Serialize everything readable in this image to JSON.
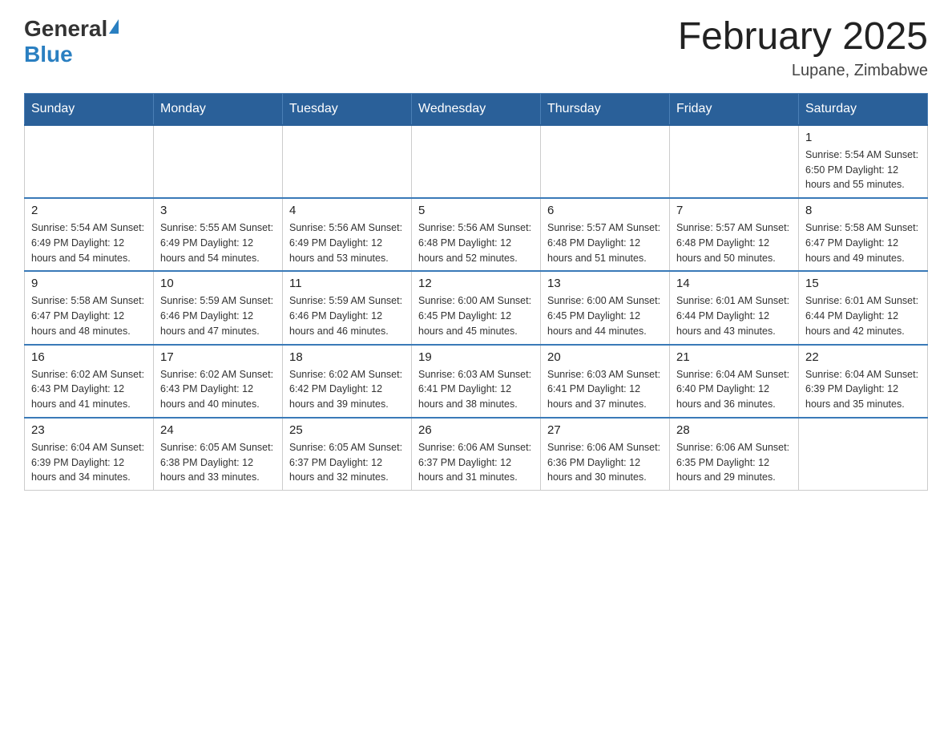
{
  "header": {
    "logo_general": "General",
    "logo_blue": "Blue",
    "month_title": "February 2025",
    "location": "Lupane, Zimbabwe"
  },
  "days_of_week": [
    "Sunday",
    "Monday",
    "Tuesday",
    "Wednesday",
    "Thursday",
    "Friday",
    "Saturday"
  ],
  "weeks": [
    {
      "days": [
        {
          "date": "",
          "info": ""
        },
        {
          "date": "",
          "info": ""
        },
        {
          "date": "",
          "info": ""
        },
        {
          "date": "",
          "info": ""
        },
        {
          "date": "",
          "info": ""
        },
        {
          "date": "",
          "info": ""
        },
        {
          "date": "1",
          "info": "Sunrise: 5:54 AM\nSunset: 6:50 PM\nDaylight: 12 hours\nand 55 minutes."
        }
      ]
    },
    {
      "days": [
        {
          "date": "2",
          "info": "Sunrise: 5:54 AM\nSunset: 6:49 PM\nDaylight: 12 hours\nand 54 minutes."
        },
        {
          "date": "3",
          "info": "Sunrise: 5:55 AM\nSunset: 6:49 PM\nDaylight: 12 hours\nand 54 minutes."
        },
        {
          "date": "4",
          "info": "Sunrise: 5:56 AM\nSunset: 6:49 PM\nDaylight: 12 hours\nand 53 minutes."
        },
        {
          "date": "5",
          "info": "Sunrise: 5:56 AM\nSunset: 6:48 PM\nDaylight: 12 hours\nand 52 minutes."
        },
        {
          "date": "6",
          "info": "Sunrise: 5:57 AM\nSunset: 6:48 PM\nDaylight: 12 hours\nand 51 minutes."
        },
        {
          "date": "7",
          "info": "Sunrise: 5:57 AM\nSunset: 6:48 PM\nDaylight: 12 hours\nand 50 minutes."
        },
        {
          "date": "8",
          "info": "Sunrise: 5:58 AM\nSunset: 6:47 PM\nDaylight: 12 hours\nand 49 minutes."
        }
      ]
    },
    {
      "days": [
        {
          "date": "9",
          "info": "Sunrise: 5:58 AM\nSunset: 6:47 PM\nDaylight: 12 hours\nand 48 minutes."
        },
        {
          "date": "10",
          "info": "Sunrise: 5:59 AM\nSunset: 6:46 PM\nDaylight: 12 hours\nand 47 minutes."
        },
        {
          "date": "11",
          "info": "Sunrise: 5:59 AM\nSunset: 6:46 PM\nDaylight: 12 hours\nand 46 minutes."
        },
        {
          "date": "12",
          "info": "Sunrise: 6:00 AM\nSunset: 6:45 PM\nDaylight: 12 hours\nand 45 minutes."
        },
        {
          "date": "13",
          "info": "Sunrise: 6:00 AM\nSunset: 6:45 PM\nDaylight: 12 hours\nand 44 minutes."
        },
        {
          "date": "14",
          "info": "Sunrise: 6:01 AM\nSunset: 6:44 PM\nDaylight: 12 hours\nand 43 minutes."
        },
        {
          "date": "15",
          "info": "Sunrise: 6:01 AM\nSunset: 6:44 PM\nDaylight: 12 hours\nand 42 minutes."
        }
      ]
    },
    {
      "days": [
        {
          "date": "16",
          "info": "Sunrise: 6:02 AM\nSunset: 6:43 PM\nDaylight: 12 hours\nand 41 minutes."
        },
        {
          "date": "17",
          "info": "Sunrise: 6:02 AM\nSunset: 6:43 PM\nDaylight: 12 hours\nand 40 minutes."
        },
        {
          "date": "18",
          "info": "Sunrise: 6:02 AM\nSunset: 6:42 PM\nDaylight: 12 hours\nand 39 minutes."
        },
        {
          "date": "19",
          "info": "Sunrise: 6:03 AM\nSunset: 6:41 PM\nDaylight: 12 hours\nand 38 minutes."
        },
        {
          "date": "20",
          "info": "Sunrise: 6:03 AM\nSunset: 6:41 PM\nDaylight: 12 hours\nand 37 minutes."
        },
        {
          "date": "21",
          "info": "Sunrise: 6:04 AM\nSunset: 6:40 PM\nDaylight: 12 hours\nand 36 minutes."
        },
        {
          "date": "22",
          "info": "Sunrise: 6:04 AM\nSunset: 6:39 PM\nDaylight: 12 hours\nand 35 minutes."
        }
      ]
    },
    {
      "days": [
        {
          "date": "23",
          "info": "Sunrise: 6:04 AM\nSunset: 6:39 PM\nDaylight: 12 hours\nand 34 minutes."
        },
        {
          "date": "24",
          "info": "Sunrise: 6:05 AM\nSunset: 6:38 PM\nDaylight: 12 hours\nand 33 minutes."
        },
        {
          "date": "25",
          "info": "Sunrise: 6:05 AM\nSunset: 6:37 PM\nDaylight: 12 hours\nand 32 minutes."
        },
        {
          "date": "26",
          "info": "Sunrise: 6:06 AM\nSunset: 6:37 PM\nDaylight: 12 hours\nand 31 minutes."
        },
        {
          "date": "27",
          "info": "Sunrise: 6:06 AM\nSunset: 6:36 PM\nDaylight: 12 hours\nand 30 minutes."
        },
        {
          "date": "28",
          "info": "Sunrise: 6:06 AM\nSunset: 6:35 PM\nDaylight: 12 hours\nand 29 minutes."
        },
        {
          "date": "",
          "info": ""
        }
      ]
    }
  ]
}
